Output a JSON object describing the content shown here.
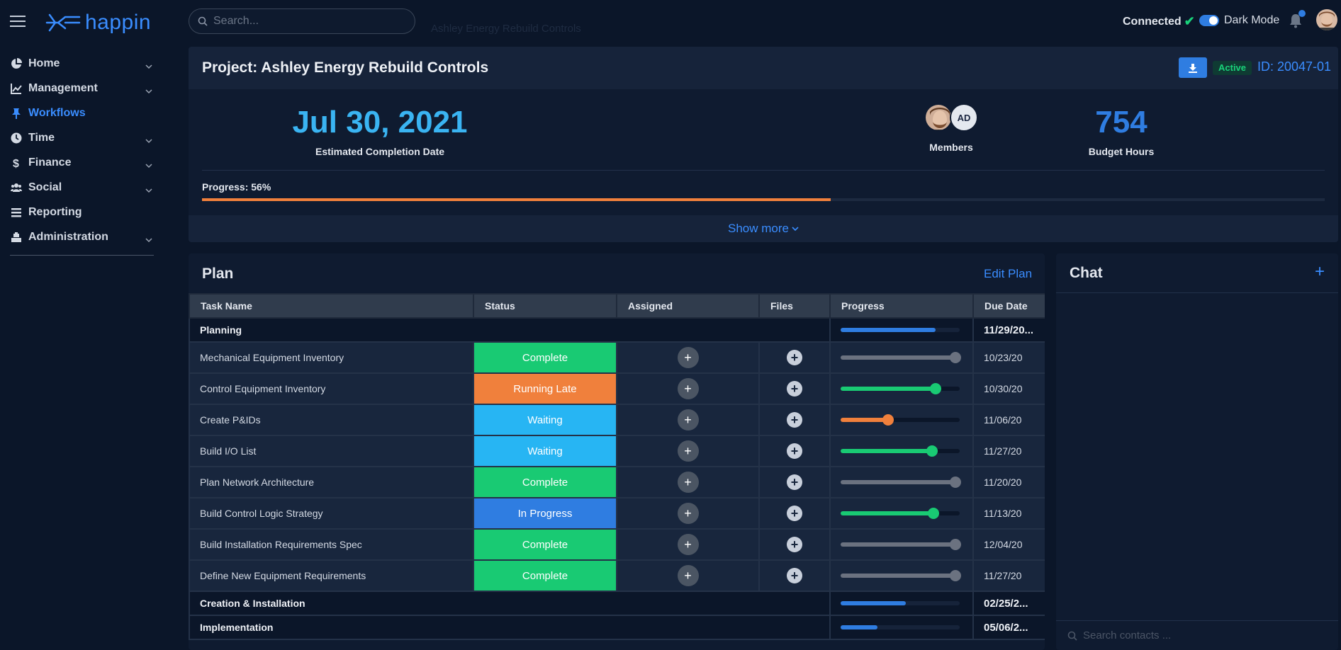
{
  "app": {
    "name": "happin"
  },
  "search": {
    "placeholder": "Search..."
  },
  "header": {
    "ghost_text": "Ashley Energy Rebuild Controls",
    "connected_label": "Connected",
    "dark_mode_label": "Dark Mode"
  },
  "sidebar": {
    "items": [
      {
        "label": "Home",
        "icon": "pie-chart-icon",
        "expandable": true,
        "active": false
      },
      {
        "label": "Management",
        "icon": "line-chart-icon",
        "expandable": true,
        "active": false
      },
      {
        "label": "Workflows",
        "icon": "pin-icon",
        "expandable": false,
        "active": true
      },
      {
        "label": "Time",
        "icon": "clock-icon",
        "expandable": true,
        "active": false
      },
      {
        "label": "Finance",
        "icon": "dollar-icon",
        "expandable": true,
        "active": false
      },
      {
        "label": "Social",
        "icon": "users-icon",
        "expandable": true,
        "active": false
      },
      {
        "label": "Reporting",
        "icon": "list-icon",
        "expandable": false,
        "active": false
      },
      {
        "label": "Administration",
        "icon": "admin-icon",
        "expandable": true,
        "active": false
      }
    ]
  },
  "project": {
    "title": "Project: Ashley Energy Rebuild Controls",
    "status_badge": "Active",
    "id_label": "ID: 20047-01",
    "completion_date": "Jul 30, 2021",
    "completion_label": "Estimated Completion Date",
    "members_label": "Members",
    "member_initials": "AD",
    "budget_hours": "754",
    "budget_label": "Budget Hours",
    "progress_label": "Progress: 56%",
    "progress_value": 0.56,
    "show_more_label": "Show more"
  },
  "plan": {
    "title": "Plan",
    "edit_label": "Edit Plan",
    "columns": [
      "Task Name",
      "Status",
      "Assigned",
      "Files",
      "Progress",
      "Due Date"
    ],
    "groups": [
      {
        "name": "Planning",
        "progress": 0.8,
        "due": "11/29/20...",
        "tasks": [
          {
            "name": "Mechanical Equipment Inventory",
            "status": "Complete",
            "status_color": "#19ca73",
            "progress": 1.0,
            "progress_color": "#6b7280",
            "due": "10/23/20"
          },
          {
            "name": "Control Equipment Inventory",
            "status": "Running Late",
            "status_color": "#f0803c",
            "progress": 0.8,
            "progress_color": "#19ca73",
            "due": "10/30/20"
          },
          {
            "name": "Create P&IDs",
            "status": "Waiting",
            "status_color": "#27b5f3",
            "progress": 0.4,
            "progress_color": "#f0803c",
            "due": "11/06/20"
          },
          {
            "name": "Build I/O List",
            "status": "Waiting",
            "status_color": "#27b5f3",
            "progress": 0.77,
            "progress_color": "#19ca73",
            "due": "11/27/20"
          },
          {
            "name": "Plan Network Architecture",
            "status": "Complete",
            "status_color": "#19ca73",
            "progress": 1.0,
            "progress_color": "#6b7280",
            "due": "11/20/20"
          },
          {
            "name": "Build Control Logic Strategy",
            "status": "In Progress",
            "status_color": "#2f7de1",
            "progress": 0.78,
            "progress_color": "#19ca73",
            "due": "11/13/20"
          },
          {
            "name": "Build Installation Requirements Spec",
            "status": "Complete",
            "status_color": "#19ca73",
            "progress": 1.0,
            "progress_color": "#6b7280",
            "due": "12/04/20"
          },
          {
            "name": "Define New Equipment Requirements",
            "status": "Complete",
            "status_color": "#19ca73",
            "progress": 1.0,
            "progress_color": "#6b7280",
            "due": "11/27/20"
          }
        ]
      },
      {
        "name": "Creation & Installation",
        "progress": 0.55,
        "due": "02/25/2...",
        "tasks": []
      },
      {
        "name": "Implementation",
        "progress": 0.31,
        "due": "05/06/2...",
        "tasks": []
      }
    ]
  },
  "chat": {
    "title": "Chat",
    "search_placeholder": "Search contacts ..."
  }
}
